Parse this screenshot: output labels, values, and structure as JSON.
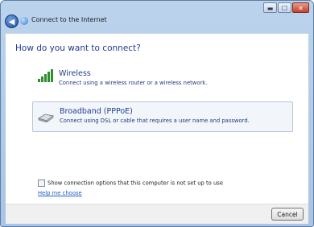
{
  "titlebar": {
    "title": "Connect to the Internet",
    "minimize_glyph": "▬",
    "maximize_glyph": "☐",
    "close_glyph": "✕",
    "back_glyph": "◀"
  },
  "main": {
    "heading": "How do you want to connect?",
    "options": [
      {
        "title": "Wireless",
        "description": "Connect using a wireless router or a wireless network.",
        "icon": "wireless-signal-icon"
      },
      {
        "title": "Broadband (PPPoE)",
        "description": "Connect using DSL or cable that requires a user name and password.",
        "icon": "modem-icon"
      }
    ],
    "checkbox_label": "Show connection options that this computer is not set up to use",
    "help_link": "Help me choose"
  },
  "footer": {
    "cancel_label": "Cancel"
  },
  "colors": {
    "link": "#1e5bc6",
    "heading": "#1e3d8f",
    "signal": "#2f8f2f"
  }
}
